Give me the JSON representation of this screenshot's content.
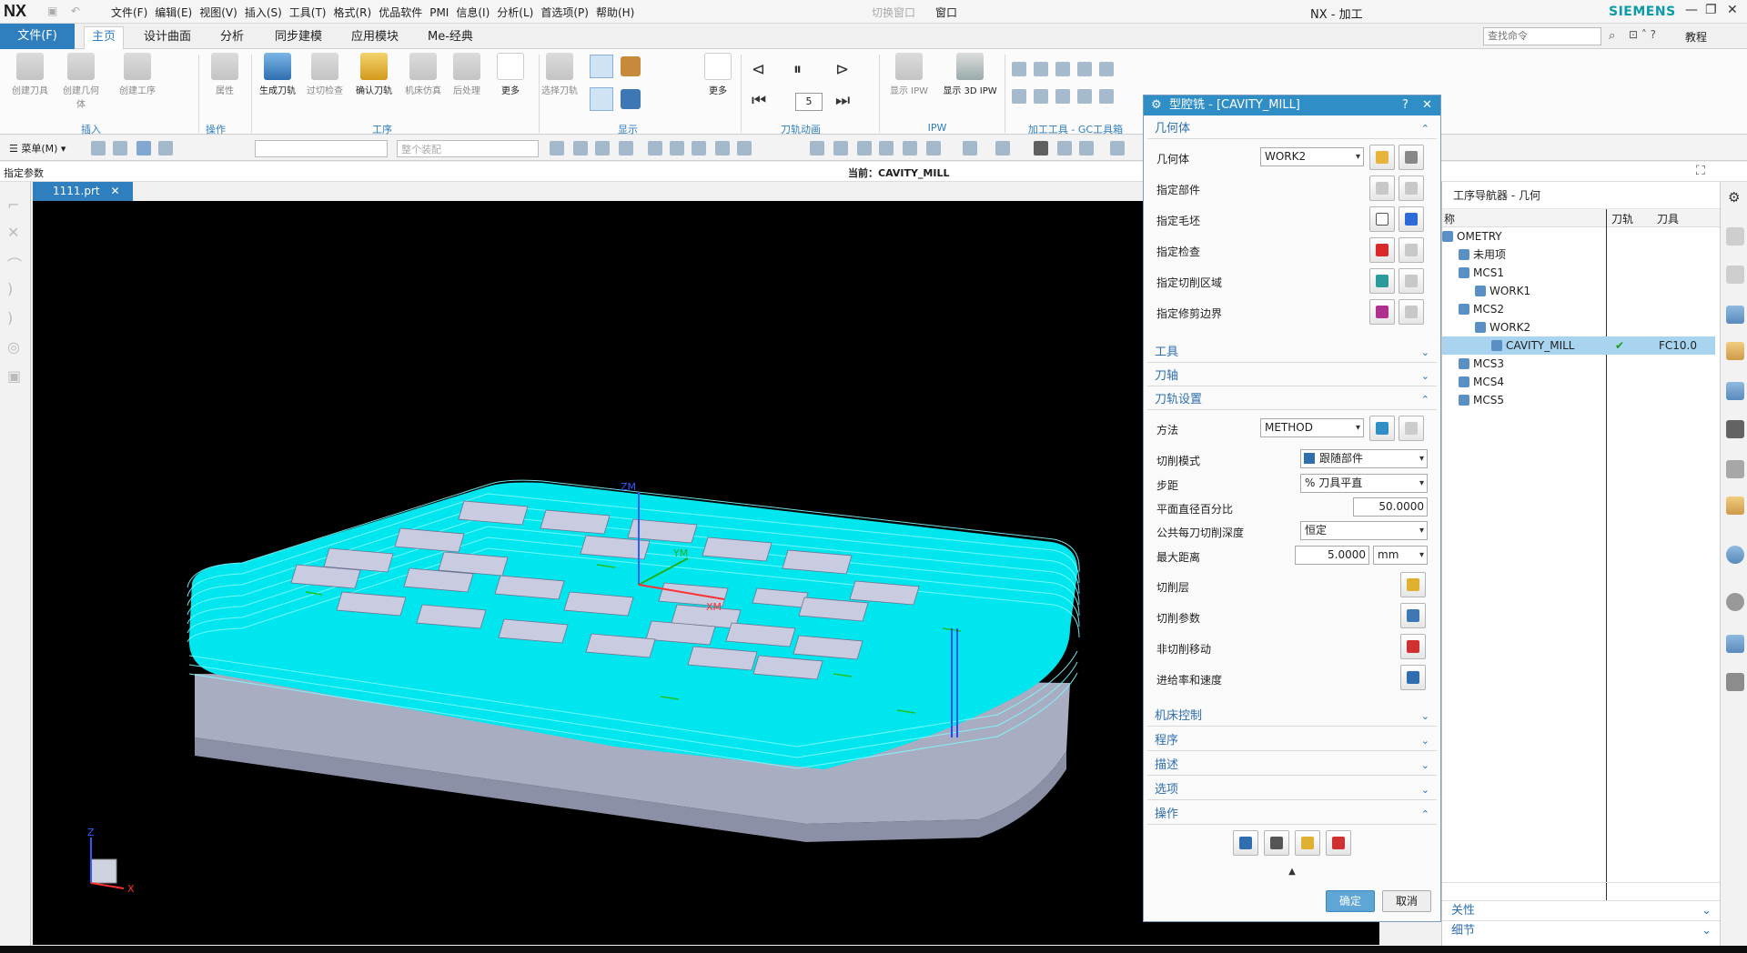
{
  "titlebar": {
    "logo": "NX",
    "menus": [
      "文件(F)",
      "编辑(E)",
      "视图(V)",
      "插入(S)",
      "工具(T)",
      "格式(R)",
      "优品软件",
      "PMI",
      "信息(I)",
      "分析(L)",
      "首选项(P)",
      "帮助(H)"
    ],
    "switch_window": "切换窗口",
    "window_menu": "窗口",
    "title": "NX - 加工",
    "brand": "SIEMENS"
  },
  "tabs": {
    "file": "文件(F)",
    "items": [
      "主页",
      "设计曲面",
      "分析",
      "同步建模",
      "应用模块",
      "Me-经典"
    ],
    "active": "主页"
  },
  "search": {
    "placeholder": "查找命令"
  },
  "help": {
    "tutorial": "教程"
  },
  "ribbon": {
    "insert_group": {
      "label": "插入",
      "buttons": [
        "创建刀具",
        "创建几何体",
        "创建工序"
      ]
    },
    "ops_group": {
      "label": "操作",
      "buttons": [
        "属性"
      ]
    },
    "process_group": {
      "label": "工序",
      "buttons": [
        "生成刀轨",
        "过切检查",
        "确认刀轨",
        "机床仿真",
        "后处理",
        "更多"
      ]
    },
    "display_group": {
      "label": "显示",
      "buttons": [
        "选择刀轨",
        "更多"
      ]
    },
    "anim_group": {
      "label": "刀轨动画",
      "speed": "5"
    },
    "ipw_group": {
      "label": "IPW",
      "buttons": [
        "显示 IPW",
        "显示 3D IPW"
      ]
    },
    "gc_group": {
      "label": "加工工具 - GC工具箱"
    }
  },
  "toolbar2": {
    "menu": "菜单(M)",
    "assembly": "整个装配"
  },
  "status": {
    "left": "指定参数",
    "current": "当前：CAVITY_MILL"
  },
  "document_tab": "1111.prt",
  "viewport": {
    "axis_zm": "ZM",
    "axis_xm": "XM",
    "axis_ym": "YM",
    "triad_z": "Z",
    "triad_x": "X"
  },
  "dialog": {
    "title": "型腔铣 - [CAVITY_MILL]",
    "geometry_section": "几何体",
    "geometry_label": "几何体",
    "geometry_value": "WORK2",
    "specify_part": "指定部件",
    "specify_blank": "指定毛坯",
    "specify_check": "指定检查",
    "specify_cut_area": "指定切削区域",
    "specify_trim": "指定修剪边界",
    "tool_section": "工具",
    "axis_section": "刀轴",
    "path_section": "刀轨设置",
    "method_label": "方法",
    "method_value": "METHOD",
    "cut_pattern_label": "切削模式",
    "cut_pattern_value": "跟随部件",
    "stepover_label": "步距",
    "stepover_value": "% 刀具平直",
    "flat_pct_label": "平面直径百分比",
    "flat_pct_value": "50.0000",
    "depth_label": "公共每刀切削深度",
    "depth_value": "恒定",
    "max_dist_label": "最大距离",
    "max_dist_value": "5.0000",
    "max_dist_unit": "mm",
    "cut_levels": "切削层",
    "cut_params": "切削参数",
    "non_cut": "非切削移动",
    "feeds": "进给率和速度",
    "machine_section": "机床控制",
    "program_section": "程序",
    "desc_section": "描述",
    "options_section": "选项",
    "actions_section": "操作",
    "ok": "确定",
    "cancel": "取消"
  },
  "navigator": {
    "header": "工序导航器 - 几何",
    "col_name": "称",
    "col_path": "刀轨",
    "col_tool": "刀具",
    "rows": [
      {
        "name": "OMETRY",
        "indent": 0,
        "path": "",
        "tool": ""
      },
      {
        "name": "未用项",
        "indent": 1,
        "path": "",
        "tool": ""
      },
      {
        "name": "MCS1",
        "indent": 1,
        "path": "",
        "tool": ""
      },
      {
        "name": "WORK1",
        "indent": 2,
        "path": "",
        "tool": ""
      },
      {
        "name": "MCS2",
        "indent": 1,
        "path": "",
        "tool": ""
      },
      {
        "name": "WORK2",
        "indent": 2,
        "path": "",
        "tool": ""
      },
      {
        "name": "CAVITY_MILL",
        "indent": 3,
        "path": "✔",
        "tool": "FC10.0"
      },
      {
        "name": "MCS3",
        "indent": 1,
        "path": "",
        "tool": ""
      },
      {
        "name": "MCS4",
        "indent": 1,
        "path": "",
        "tool": ""
      },
      {
        "name": "MCS5",
        "indent": 1,
        "path": "",
        "tool": ""
      }
    ],
    "bottom1": "关性",
    "bottom2": "细节"
  }
}
